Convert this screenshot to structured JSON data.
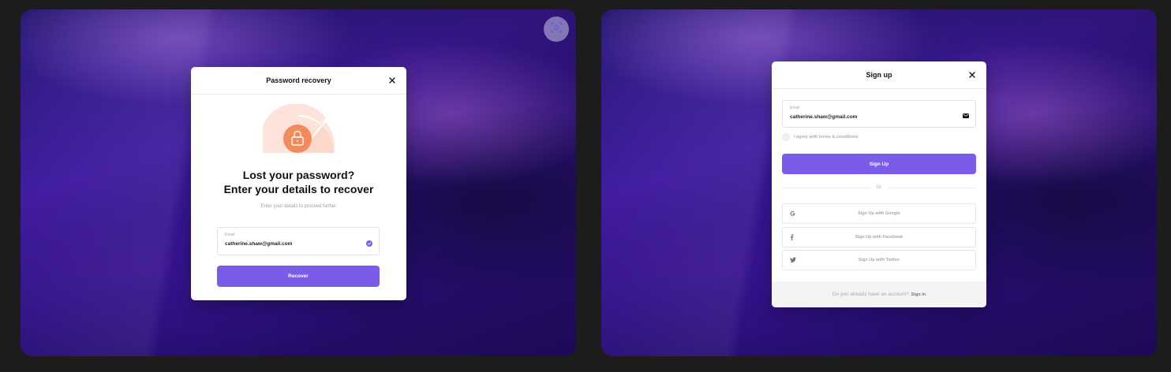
{
  "left_panel": {
    "recovery": {
      "title": "Password recovery",
      "headline_1": "Lost your password?",
      "headline_2": "Enter your details to recover",
      "subtext": "Enter your details to proceed further",
      "email_label": "Email",
      "email_value": "catherine.shaw@gmail.com",
      "submit_label": "Recover"
    }
  },
  "right_panel": {
    "signup": {
      "title": "Sign up",
      "email_label": "Email",
      "email_value": "catherine.shaw@gmail.com",
      "agree_label": "I agree with terms & conditions",
      "submit_label": "Sign Up",
      "divider_label": "Or",
      "google_label": "Sign Up with Google",
      "facebook_label": "Sign Up with Facebook",
      "twitter_label": "Sign Up with Twitter",
      "footer_text": "Do you already have an account?",
      "signin_label": "Sign in"
    }
  },
  "colors": {
    "accent": "#7b5ce8",
    "illustration_orange": "#f28a5b",
    "illustration_peach": "#fde3da"
  },
  "icons": {
    "scan": "scan-icon",
    "close": "close-icon",
    "lock": "lock-icon",
    "check": "check-circle-icon",
    "mail": "mail-icon",
    "google": "google-icon",
    "facebook": "facebook-icon",
    "twitter": "twitter-icon"
  }
}
